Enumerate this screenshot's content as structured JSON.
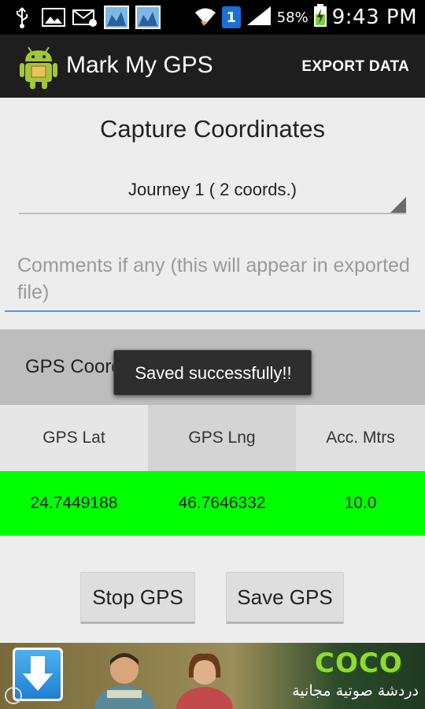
{
  "status_bar": {
    "icons_left": [
      "usb-icon",
      "image-icon",
      "mail-icon",
      "screenshot-icon",
      "screenshot-icon"
    ],
    "notification_count": "1",
    "battery_percent": "58%",
    "time": "9:43 PM"
  },
  "action_bar": {
    "title": "Mark My GPS",
    "export_label": "EXPORT DATA"
  },
  "main": {
    "heading": "Capture Coordinates",
    "journey_selected": "Journey 1 ( 2 coords.)",
    "comment_placeholder": "Comments if any (this will appear in exported file)",
    "coords_label": "GPS Coordinates"
  },
  "toast": {
    "message": "Saved successfully!!"
  },
  "table": {
    "headers": [
      "GPS Lat",
      "GPS Lng",
      "Acc. Mtrs"
    ],
    "row": [
      "24.7449188",
      "46.7646332",
      "10.0"
    ]
  },
  "buttons": {
    "stop_label": "Stop GPS",
    "save_label": "Save GPS"
  },
  "ad": {
    "brand": "COCO",
    "tagline": "دردشة صوتية مجانية",
    "info_label": "i"
  },
  "colors": {
    "row_highlight": "#00ff00",
    "input_underline": "#4aa3d8",
    "action_bar": "#1e1e1e"
  }
}
